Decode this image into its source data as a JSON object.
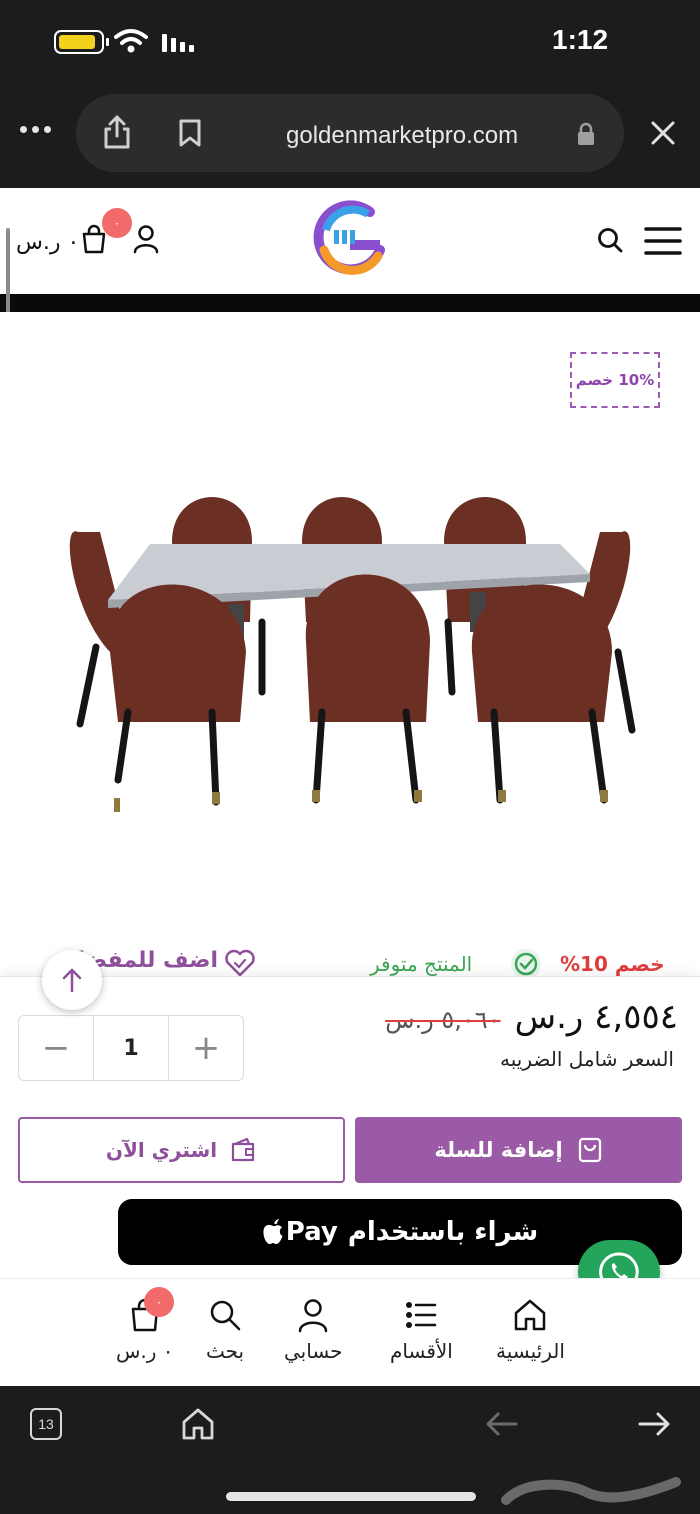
{
  "status_bar": {
    "time": "1:12"
  },
  "browser": {
    "url": "goldenmarketpro.com",
    "tab_count": "13"
  },
  "header": {
    "cart_total": "٠ ر.س",
    "cart_count": "٠"
  },
  "product": {
    "discount_badge": "10% خصم",
    "discount_text": "خصم 10%",
    "stock_status": "المنتج متوفر",
    "wishlist_label": "اضف للمفضلة",
    "price_current": "٤,٥٥٤ ر.س",
    "price_old": "٥,٠٦٠ ر.س",
    "tax_note": "السعر شامل الضريبه",
    "quantity": "1"
  },
  "actions": {
    "add_to_cart": "إضافة للسلة",
    "buy_now": "اشتري الآن",
    "apple_pay_prefix": "شراء باستخدام",
    "apple_pay_brand": "Pay"
  },
  "bottom_nav": {
    "home": "الرئيسية",
    "categories": "الأقسام",
    "account": "حسابي",
    "search": "بحث",
    "cart": "٠ ر.س",
    "cart_count": "٠"
  },
  "colors": {
    "accent": "#9b5aa6",
    "discount_red": "#e03c3c",
    "stock_green": "#3aa655",
    "whatsapp": "#25a45b",
    "badge": "#f26b6b"
  }
}
